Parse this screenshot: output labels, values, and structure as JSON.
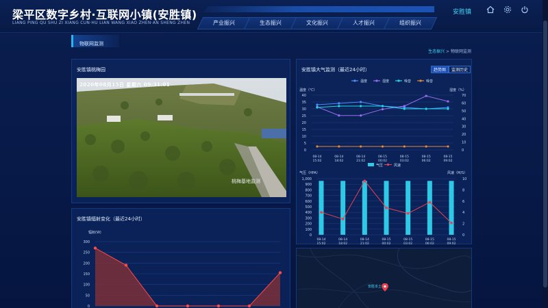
{
  "header": {
    "title": "梁平区数字乡村·互联网小镇(安胜镇)",
    "subtitle": "LIANG PING QU SHU ZI XIANG CUN·HU LIAN WANG XIAO ZHEN·AN SHENG ZHEN",
    "location": "安胜镇",
    "icons": [
      "home-icon",
      "settings-icon",
      "power-icon"
    ],
    "nav": [
      "产业振兴",
      "生态振兴",
      "文化振兴",
      "人才振兴",
      "组织振兴"
    ]
  },
  "page": {
    "title": "物联网监测",
    "breadcrumb": {
      "parent": "生态振兴",
      "separator": ">",
      "current": "物联网监测"
    }
  },
  "camera": {
    "title": "安胜镇桃梅园",
    "timestamp": "2020年08月15日  星期六  09:31:01",
    "caption": "桃梅基地监测"
  },
  "radiation": {
    "title": "安胜镇辐射变化（最近24小时）",
    "chart_data": {
      "type": "area",
      "title": "安胜镇辐射变化（最近24小时）",
      "ylabel": "辐射(W)",
      "ylim": [
        0,
        300
      ],
      "yticks": [
        0,
        50,
        100,
        150,
        200,
        250,
        300
      ],
      "values": [
        270,
        190,
        0,
        0,
        0,
        0,
        155
      ],
      "colors": {
        "line": "#ff4a4a",
        "fill": "#7a2f3a"
      }
    }
  },
  "atmosphere": {
    "title": "安胜镇大气监测（最近24小时）",
    "buttons": [
      "趋势图",
      "监测历史"
    ],
    "temp_chart": {
      "type": "line",
      "xlabels": [
        [
          "08-14",
          "15:02"
        ],
        [
          "08-14",
          "18:02"
        ],
        [
          "08-14",
          "21:02"
        ],
        [
          "08-15",
          "00:02"
        ],
        [
          "08-15",
          "03:02"
        ],
        [
          "08-15",
          "06:02"
        ],
        [
          "08-15",
          "09:02"
        ]
      ],
      "left_axis": {
        "label": "温度（℃）",
        "ylim": [
          0,
          40
        ],
        "ticks": [
          0,
          5,
          10,
          15,
          20,
          25,
          30,
          35,
          40
        ]
      },
      "right_axis": {
        "label": "湿度（%）",
        "ylim": [
          0,
          70
        ],
        "ticks": [
          0,
          10,
          20,
          30,
          40,
          50,
          60,
          70
        ]
      },
      "series": [
        {
          "name": "温度",
          "axis": "left",
          "color": "#4a90ff",
          "values": [
            33,
            34,
            35,
            32,
            31,
            30,
            31
          ]
        },
        {
          "name": "湿度",
          "axis": "right",
          "color": "#9b6cf0",
          "values": [
            55,
            44,
            44,
            52,
            56,
            69,
            62
          ]
        },
        {
          "name": "噪音",
          "axis": "left",
          "color": "#22d8e6",
          "values": [
            31,
            32,
            32,
            32,
            30,
            30,
            30
          ]
        },
        {
          "name": "噪音",
          "axis": "left",
          "color": "#e08a3a",
          "values": [
            2.5,
            2.5,
            2.5,
            2.5,
            2.5,
            2.5,
            2.5
          ]
        }
      ]
    },
    "pressure_chart": {
      "type": "bar",
      "xlabels": [
        [
          "08-14",
          "15:02"
        ],
        [
          "08-14",
          "18:02"
        ],
        [
          "08-14",
          "21:02"
        ],
        [
          "08-15",
          "00:02"
        ],
        [
          "08-15",
          "03:02"
        ],
        [
          "08-15",
          "06:02"
        ],
        [
          "08-15",
          "09:02"
        ]
      ],
      "left_axis": {
        "label": "气压（HPA）",
        "ylim": [
          0,
          1000
        ],
        "ticks": [
          0,
          100,
          200,
          300,
          400,
          500,
          600,
          700,
          800,
          900,
          1000
        ]
      },
      "right_axis": {
        "label": "风速（M/S）",
        "ylim": [
          0,
          10
        ],
        "ticks": [
          0,
          2,
          4,
          6,
          8,
          10
        ]
      },
      "series": [
        {
          "name": "气压",
          "kind": "bar",
          "axis": "left",
          "color": "#2ec9e6",
          "values": [
            960,
            960,
            960,
            960,
            960,
            960,
            960
          ]
        },
        {
          "name": "风速",
          "kind": "line",
          "axis": "right",
          "color": "#e8424f",
          "values": [
            4,
            2.8,
            9.6,
            4.8,
            3.8,
            5.8,
            2.1
          ]
        }
      ]
    }
  },
  "map": {
    "label": "安胜本土"
  }
}
